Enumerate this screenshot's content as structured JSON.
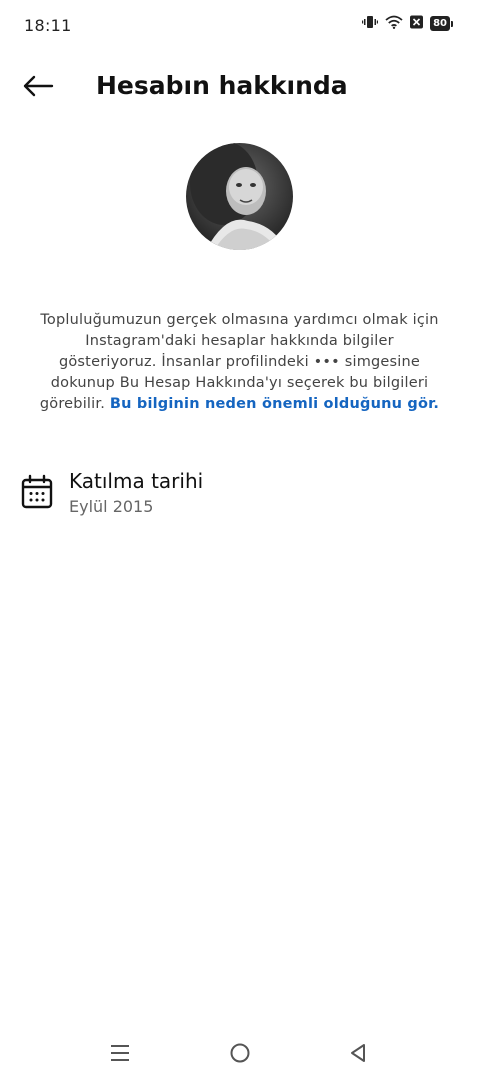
{
  "status_bar": {
    "time": "18:11",
    "battery": "80",
    "icons": [
      "vibrate-icon",
      "wifi-icon",
      "sim-blocked-icon",
      "battery-icon"
    ]
  },
  "header": {
    "title": "Hesabın hakkında",
    "back_icon": "arrow-left-icon"
  },
  "profile": {
    "avatar": "profile-photo"
  },
  "info": {
    "text": "Topluluğumuzun gerçek olmasına yardımcı olmak için Instagram'daki hesaplar hakkında bilgiler gösteriyoruz. İnsanlar profilindeki ••• simgesine dokunup Bu Hesap Hakkında'yı seçerek bu bilgileri görebilir. ",
    "link": "Bu bilginin neden önemli olduğunu gör."
  },
  "join_date": {
    "icon": "calendar-icon",
    "label": "Katılma tarihi",
    "value": "Eylül 2015"
  },
  "nav_bar": {
    "buttons": [
      "menu-icon",
      "home-circle-icon",
      "back-triangle-icon"
    ]
  },
  "colors": {
    "link": "#1565c0",
    "text": "#111111",
    "secondary": "#666666"
  }
}
